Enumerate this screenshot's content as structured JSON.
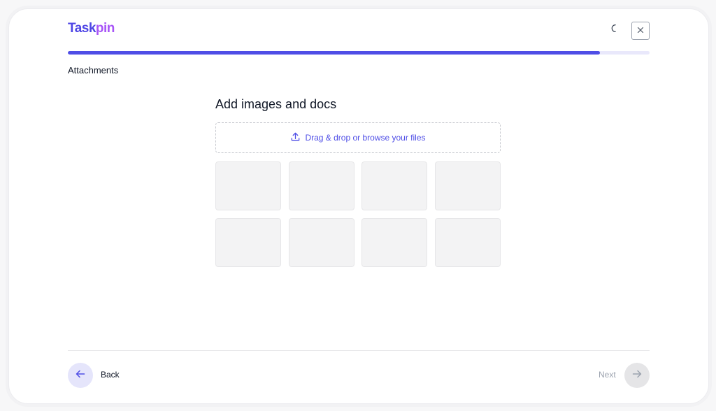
{
  "brand": {
    "logo_main": "Task",
    "logo_tail": "pin",
    "primary_color": "#4f46e5",
    "accent_color": "#a855f7"
  },
  "header": {
    "theme_toggle_icon": "moon-icon",
    "close_icon": "close-icon",
    "progress_fraction": 0.915
  },
  "step": {
    "title": "Attachments"
  },
  "main": {
    "heading": "Add images and docs",
    "dropzone": {
      "icon": "upload-icon",
      "label": "Drag & drop or browse your files"
    },
    "thumbnails": [
      {
        "state": "empty"
      },
      {
        "state": "empty"
      },
      {
        "state": "empty"
      },
      {
        "state": "empty"
      },
      {
        "state": "empty"
      },
      {
        "state": "empty"
      },
      {
        "state": "empty"
      },
      {
        "state": "empty"
      }
    ]
  },
  "footer": {
    "back_label": "Back",
    "back_icon": "arrow-left-icon",
    "next_label": "Next",
    "next_icon": "arrow-right-icon",
    "next_disabled": true
  }
}
